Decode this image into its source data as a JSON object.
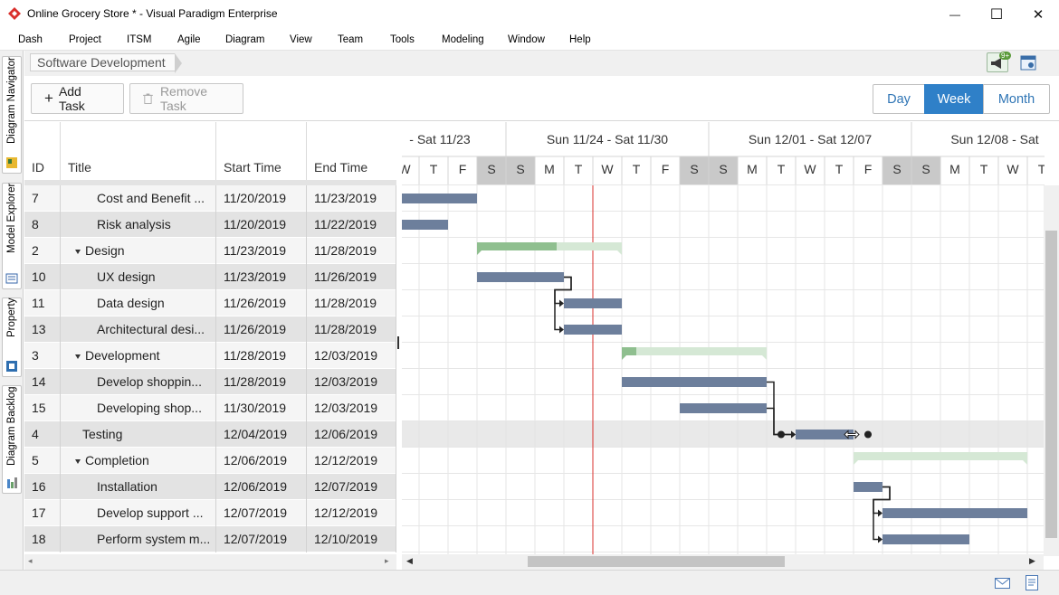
{
  "window": {
    "title": "Online Grocery Store * - Visual Paradigm Enterprise",
    "minimize_glyph": "—",
    "maximize_glyph": "☐",
    "close_glyph": "✕"
  },
  "menu": [
    "Dash",
    "Project",
    "ITSM",
    "Agile",
    "Diagram",
    "View",
    "Team",
    "Tools",
    "Modeling",
    "Window",
    "Help"
  ],
  "side_tabs": [
    {
      "label": "Diagram Navigator",
      "icon": "diagram-navigator-icon"
    },
    {
      "label": "Model Explorer",
      "icon": "model-explorer-icon"
    },
    {
      "label": "Property",
      "icon": "property-icon"
    },
    {
      "label": "Diagram Backlog",
      "icon": "diagram-backlog-icon"
    }
  ],
  "breadcrumb": "Software Development",
  "notification_badge": "9+",
  "toolbar": {
    "add_task_glyph": "+",
    "add_task": "Add Task",
    "remove_task": "Remove Task",
    "views": [
      "Day",
      "Week",
      "Month"
    ],
    "active_view": "Week"
  },
  "table": {
    "columns": [
      "ID",
      "Title",
      "Start Time",
      "End Time"
    ],
    "rows": [
      {
        "id": "7",
        "title": "Cost and Benefit ...",
        "start": "11/20/2019",
        "end": "11/23/2019",
        "indent": 2,
        "group": false
      },
      {
        "id": "8",
        "title": "Risk analysis",
        "start": "11/20/2019",
        "end": "11/22/2019",
        "indent": 2,
        "group": false
      },
      {
        "id": "2",
        "title": "Design",
        "start": "11/23/2019",
        "end": "11/28/2019",
        "indent": 1,
        "group": true
      },
      {
        "id": "10",
        "title": "UX design",
        "start": "11/23/2019",
        "end": "11/26/2019",
        "indent": 2,
        "group": false
      },
      {
        "id": "11",
        "title": "Data design",
        "start": "11/26/2019",
        "end": "11/28/2019",
        "indent": 2,
        "group": false
      },
      {
        "id": "13",
        "title": "Architectural desi...",
        "start": "11/26/2019",
        "end": "11/28/2019",
        "indent": 2,
        "group": false
      },
      {
        "id": "3",
        "title": "Development",
        "start": "11/28/2019",
        "end": "12/03/2019",
        "indent": 1,
        "group": true
      },
      {
        "id": "14",
        "title": "Develop shoppin...",
        "start": "11/28/2019",
        "end": "12/03/2019",
        "indent": 2,
        "group": false
      },
      {
        "id": "15",
        "title": "Developing shop...",
        "start": "11/30/2019",
        "end": "12/03/2019",
        "indent": 2,
        "group": false
      },
      {
        "id": "4",
        "title": "Testing",
        "start": "12/04/2019",
        "end": "12/06/2019",
        "indent": 1,
        "group": false
      },
      {
        "id": "5",
        "title": "Completion",
        "start": "12/06/2019",
        "end": "12/12/2019",
        "indent": 1,
        "group": true
      },
      {
        "id": "16",
        "title": "Installation",
        "start": "12/06/2019",
        "end": "12/07/2019",
        "indent": 2,
        "group": false
      },
      {
        "id": "17",
        "title": "Develop support ...",
        "start": "12/07/2019",
        "end": "12/12/2019",
        "indent": 2,
        "group": false
      },
      {
        "id": "18",
        "title": "Perform system m...",
        "start": "12/07/2019",
        "end": "12/10/2019",
        "indent": 2,
        "group": false
      }
    ]
  },
  "gantt": {
    "weeks": [
      "- Sat 11/23",
      "Sun 11/24 - Sat 11/30",
      "Sun 12/01 - Sat 12/07",
      "Sun 12/08 - Sat"
    ],
    "days": [
      "W",
      "T",
      "F",
      "S",
      "S",
      "M",
      "T",
      "W",
      "T",
      "F",
      "S",
      "S",
      "M",
      "T",
      "W",
      "T",
      "F",
      "S",
      "S",
      "M",
      "T",
      "W",
      "T"
    ],
    "first_day": "11/20/2019",
    "weekend_day_indices": [
      3,
      4,
      10,
      11,
      17,
      18
    ],
    "today_index": 7,
    "selected_row_index": 9,
    "task_color": "#6d7f9c",
    "group_done_color": "#8fbf8f",
    "group_remaining_color": "#d5e8d5",
    "today_line_color": "#d9302c",
    "weekend_color": "#d0d0d0",
    "bars": [
      {
        "row": 0,
        "type": "task",
        "start": "11/20/2019",
        "end": "11/23/2019"
      },
      {
        "row": 1,
        "type": "task",
        "start": "11/20/2019",
        "end": "11/22/2019"
      },
      {
        "row": 2,
        "type": "group",
        "start": "11/23/2019",
        "end": "11/28/2019",
        "progress": 0.55
      },
      {
        "row": 3,
        "type": "task",
        "start": "11/23/2019",
        "end": "11/26/2019"
      },
      {
        "row": 4,
        "type": "task",
        "start": "11/26/2019",
        "end": "11/28/2019"
      },
      {
        "row": 5,
        "type": "task",
        "start": "11/26/2019",
        "end": "11/28/2019"
      },
      {
        "row": 6,
        "type": "group",
        "start": "11/28/2019",
        "end": "12/03/2019",
        "progress": 0.1
      },
      {
        "row": 7,
        "type": "task",
        "start": "11/28/2019",
        "end": "12/03/2019"
      },
      {
        "row": 8,
        "type": "task",
        "start": "11/30/2019",
        "end": "12/03/2019"
      },
      {
        "row": 9,
        "type": "task",
        "start": "12/04/2019",
        "end": "12/06/2019"
      },
      {
        "row": 10,
        "type": "group",
        "start": "12/06/2019",
        "end": "12/12/2019",
        "progress": 0
      },
      {
        "row": 11,
        "type": "task",
        "start": "12/06/2019",
        "end": "12/07/2019"
      },
      {
        "row": 12,
        "type": "task",
        "start": "12/07/2019",
        "end": "12/12/2019"
      },
      {
        "row": 13,
        "type": "task",
        "start": "12/07/2019",
        "end": "12/10/2019"
      }
    ],
    "dependencies": [
      {
        "from": 3,
        "to": 4
      },
      {
        "from": 3,
        "to": 5
      },
      {
        "from": 7,
        "to": 9
      },
      {
        "from": 8,
        "to": 9
      },
      {
        "from": 11,
        "to": 12
      },
      {
        "from": 11,
        "to": 13
      }
    ]
  }
}
